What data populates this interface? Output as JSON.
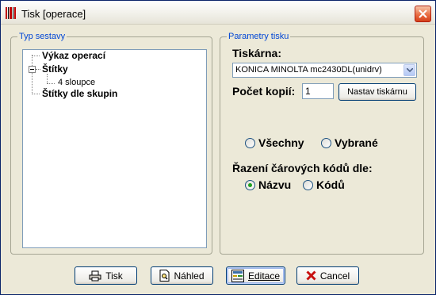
{
  "window": {
    "title": "Tisk [operace]"
  },
  "report_type": {
    "legend": "Typ sestavy",
    "tree": [
      {
        "label": "Výkaz operací"
      },
      {
        "label": "Štítky"
      },
      {
        "label": "4 sloupce"
      },
      {
        "label": "Štítky dle skupin"
      }
    ]
  },
  "print_params": {
    "legend": "Parametry tisku",
    "printer_label": "Tiskárna:",
    "printer_value": "KONICA MINOLTA mc2430DL(unidrv)",
    "copies_label": "Počet kopií:",
    "copies_value": "1",
    "printer_settings_button": "Nastav tiskárnu",
    "range_options": [
      {
        "label": "Všechny",
        "selected": false
      },
      {
        "label": "Vybrané",
        "selected": false
      }
    ],
    "sort_label": "Řazení čárových kódů dle:",
    "sort_options": [
      {
        "label": "Názvu",
        "selected": true
      },
      {
        "label": "Kódů",
        "selected": false
      }
    ]
  },
  "buttons": {
    "print": "Tisk",
    "preview": "Náhled",
    "edit": "Editace",
    "cancel": "Cancel"
  },
  "colors": {
    "legend": "#0046d5",
    "radio_selected": "#21a121",
    "cancel_icon": "#c81010"
  }
}
